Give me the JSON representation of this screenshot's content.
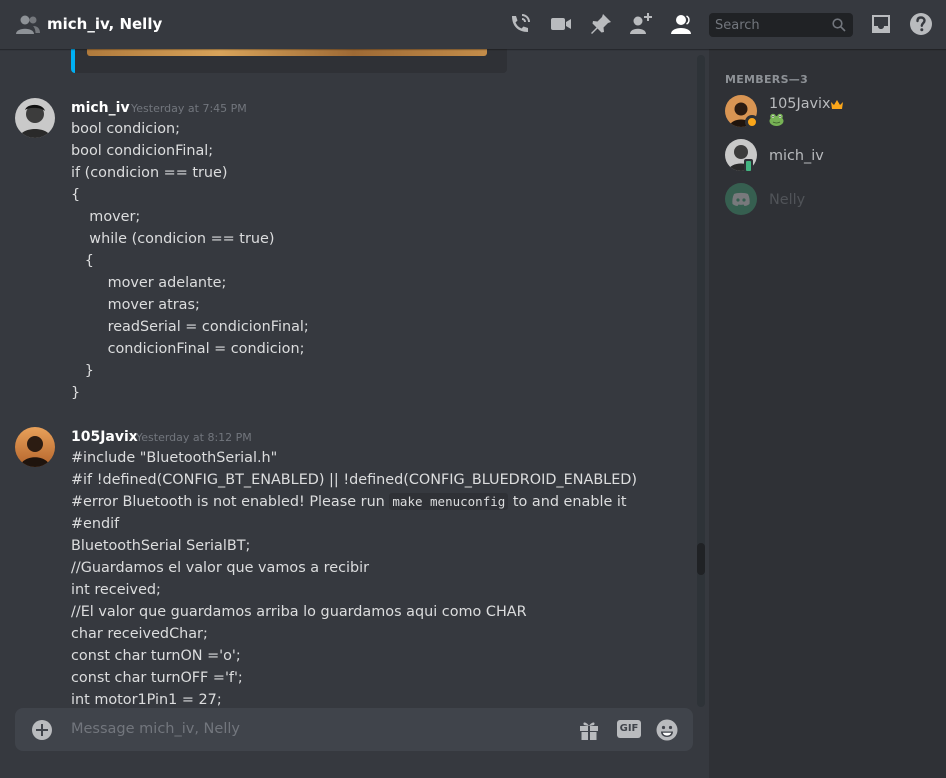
{
  "header": {
    "title": "mich_iv, Nelly",
    "search_placeholder": "Search",
    "icons": [
      "people-icon",
      "call-icon",
      "video-icon",
      "pin-icon",
      "add-friend-icon",
      "member-list-icon",
      "search-icon",
      "inbox-icon",
      "help-icon"
    ]
  },
  "messages": [
    {
      "author": "mich_iv",
      "timestamp": "Yesterday at 7:45 PM",
      "lines": [
        "bool condicion;",
        "bool condicionFinal;",
        "if (condicion == true)",
        "{",
        "    mover;",
        "    while (condicion == true)",
        "   {",
        "        mover adelante;",
        "        mover atras;",
        "        readSerial = condicionFinal;",
        "        condicionFinal = condicion;",
        "   }",
        "}"
      ]
    },
    {
      "author": "105Javix",
      "timestamp": "Yesterday at 8:12 PM",
      "lines": [
        "#include \"BluetoothSerial.h\"",
        "#if !defined(CONFIG_BT_ENABLED) || !defined(CONFIG_BLUEDROID_ENABLED)",
        "#error Bluetooth is not enabled! Please run ",
        "#endif",
        "BluetoothSerial SerialBT;",
        "//Guardamos el valor que vamos a recibir",
        "int received;",
        "//El valor que guardamos arriba lo guardamos aqui como CHAR",
        "char receivedChar;",
        "const char turnON ='o';",
        "const char turnOFF ='f';",
        "int motor1Pin1 = 27;"
      ],
      "error_line_code": "make menuconfig",
      "error_line_tail": " to and enable it"
    }
  ],
  "composer": {
    "placeholder": "Message mich_iv, Nelly",
    "gif_label": "GIF"
  },
  "members": {
    "header": "MEMBERS—3",
    "list": [
      {
        "name": "105Javix",
        "status": "idle",
        "badge": "crown-icon",
        "activity_icon": "frog-emoji-icon",
        "color": "#8e9297"
      },
      {
        "name": "mich_iv",
        "status": "mobile-online",
        "color": "#8e9297"
      },
      {
        "name": "Nelly",
        "status": "offline",
        "color": "#52565c"
      }
    ]
  },
  "colors": {
    "background": "#36393f",
    "sidebar": "#2f3136",
    "accent": "#00b0f4",
    "online": "#43b581",
    "idle": "#faa61a",
    "crown": "#faa61a"
  }
}
